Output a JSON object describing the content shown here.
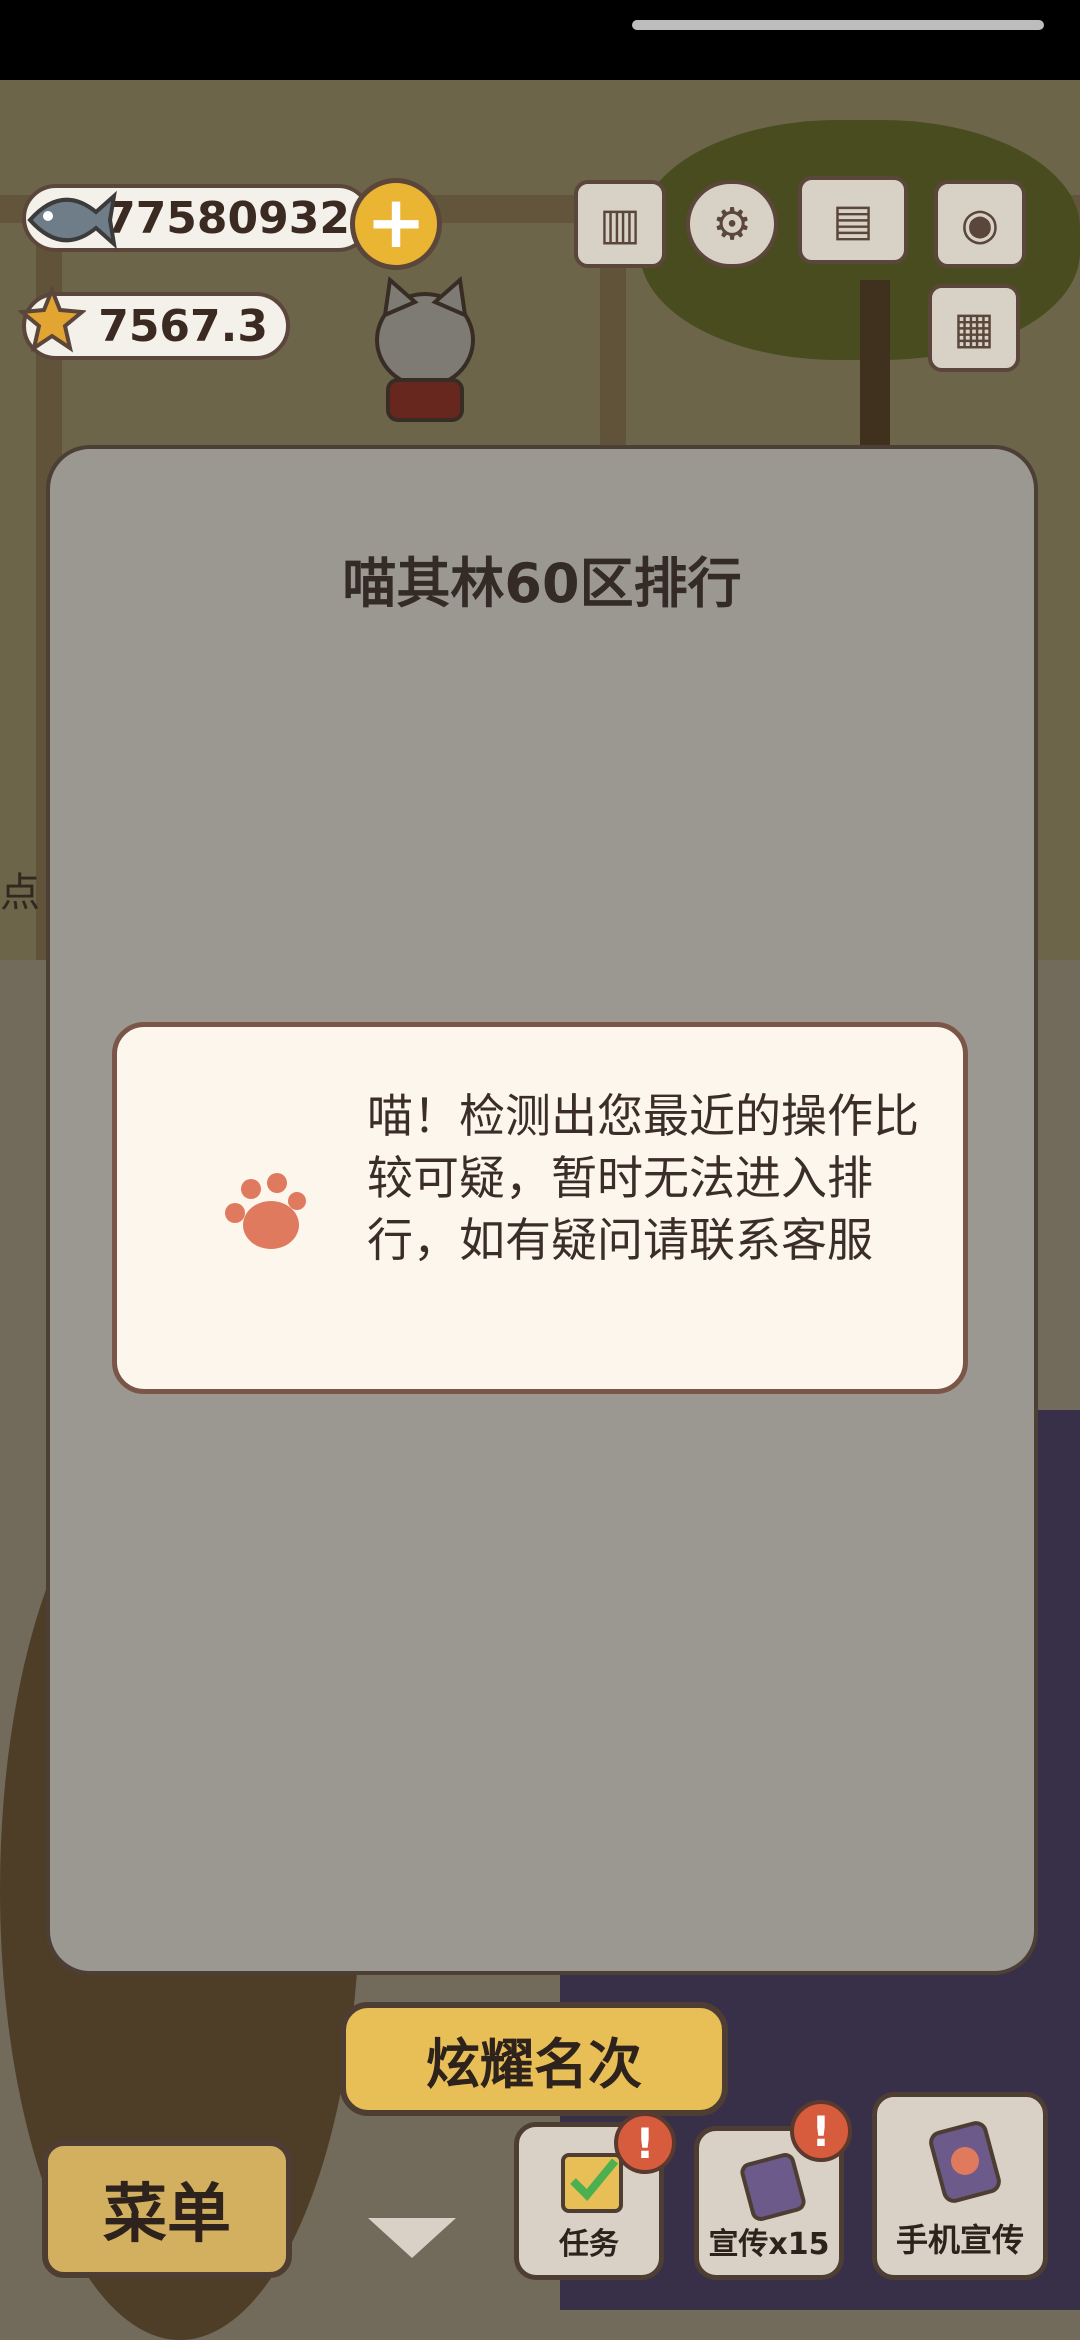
{
  "currency": {
    "fish_value": "77580932",
    "star_value": "7567.3"
  },
  "modal": {
    "title": "喵其林60区排行",
    "toast_message": "喵！检测出您最近的操作比较可疑，暂时无法进入排行，如有疑问请联系客服"
  },
  "bottom": {
    "rank_button": "炫耀名次",
    "menu_button": "菜单",
    "tasks_button": "任务",
    "promo_button": "宣传x15",
    "phone_promo_button": "手机宣传",
    "badge_mark": "!"
  },
  "background_text": "点",
  "colors": {
    "accent_yellow": "#e8bf56",
    "paw": "#e07a5f",
    "border_brown": "#5a463a"
  },
  "icons": [
    "fish-icon",
    "plus-icon",
    "star-icon",
    "ranking-icon",
    "gear-icon",
    "book-icon",
    "camera-icon",
    "newspaper-icon",
    "paw-icon",
    "chevron-down-icon"
  ]
}
